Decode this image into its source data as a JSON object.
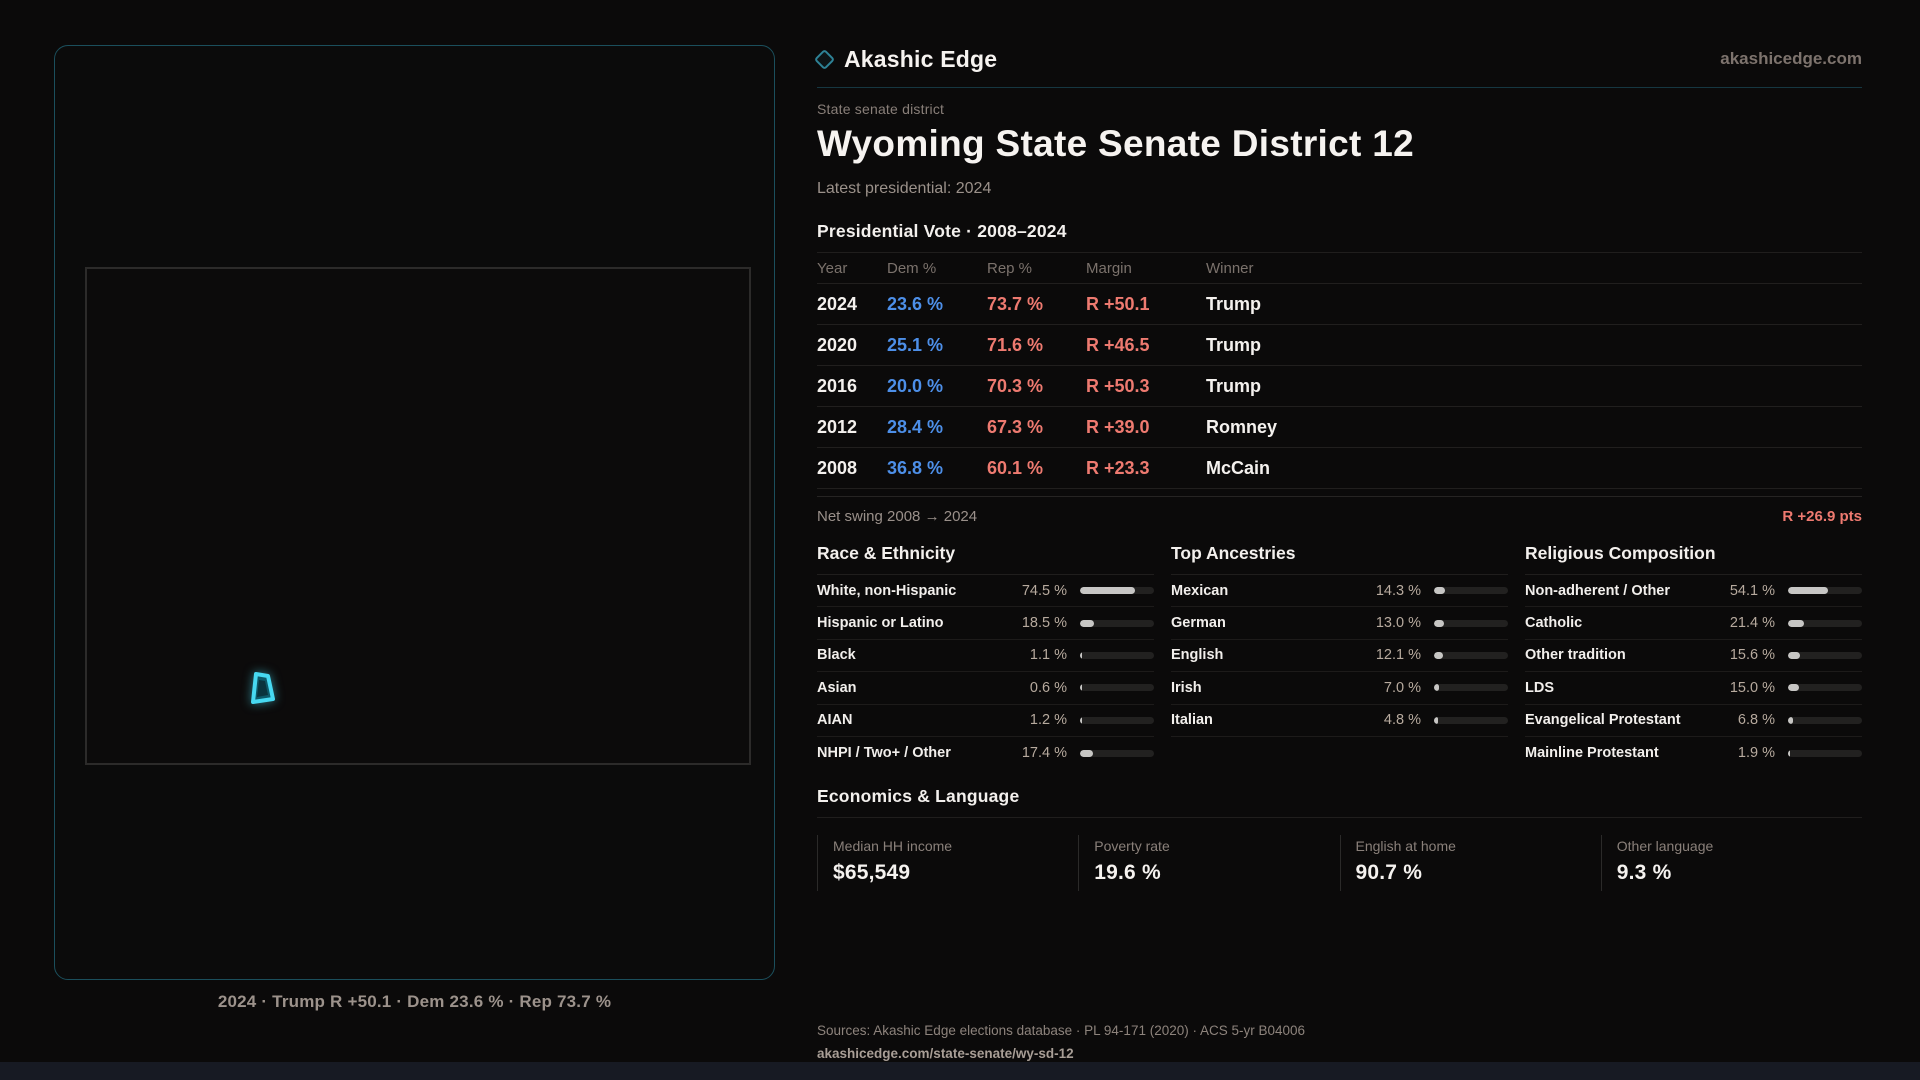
{
  "brand": {
    "name": "Akashic Edge",
    "domain": "akashicedge.com"
  },
  "page": {
    "eyebrow": "State senate district",
    "title": "Wyoming State Senate District 12",
    "latest": "Latest presidential: 2024"
  },
  "map": {
    "caption": "2024 · Trump R +50.1 · Dem 23.6 % · Rep 73.7 %",
    "district_color": "#47d9f1"
  },
  "vote_table": {
    "title": "Presidential Vote · 2008–2024",
    "columns": [
      "Year",
      "Dem %",
      "Rep %",
      "Margin",
      "Winner"
    ],
    "rows": [
      {
        "year": "2024",
        "dem": "23.6 %",
        "rep": "73.7 %",
        "margin": "R +50.1",
        "winner": "Trump"
      },
      {
        "year": "2020",
        "dem": "25.1 %",
        "rep": "71.6 %",
        "margin": "R +46.5",
        "winner": "Trump"
      },
      {
        "year": "2016",
        "dem": "20.0 %",
        "rep": "70.3 %",
        "margin": "R +50.3",
        "winner": "Trump"
      },
      {
        "year": "2012",
        "dem": "28.4 %",
        "rep": "67.3 %",
        "margin": "R +39.0",
        "winner": "Romney"
      },
      {
        "year": "2008",
        "dem": "36.8 %",
        "rep": "60.1 %",
        "margin": "R +23.3",
        "winner": "McCain"
      }
    ],
    "net_swing_label": "Net swing 2008 → 2024",
    "net_swing_value": "R +26.9 pts"
  },
  "demographics": [
    {
      "title": "Race & Ethnicity",
      "rows": [
        {
          "label": "White, non-Hispanic",
          "value": "74.5 %",
          "pct": 74.5
        },
        {
          "label": "Hispanic or Latino",
          "value": "18.5 %",
          "pct": 18.5
        },
        {
          "label": "Black",
          "value": "1.1 %",
          "pct": 1.1
        },
        {
          "label": "Asian",
          "value": "0.6 %",
          "pct": 0.6
        },
        {
          "label": "AIAN",
          "value": "1.2 %",
          "pct": 1.2
        },
        {
          "label": "NHPI / Two+ / Other",
          "value": "17.4 %",
          "pct": 17.4
        }
      ]
    },
    {
      "title": "Top Ancestries",
      "rows": [
        {
          "label": "Mexican",
          "value": "14.3 %",
          "pct": 14.3
        },
        {
          "label": "German",
          "value": "13.0 %",
          "pct": 13.0
        },
        {
          "label": "English",
          "value": "12.1 %",
          "pct": 12.1
        },
        {
          "label": "Irish",
          "value": "7.0 %",
          "pct": 7.0
        },
        {
          "label": "Italian",
          "value": "4.8 %",
          "pct": 4.8
        }
      ]
    },
    {
      "title": "Religious Composition",
      "rows": [
        {
          "label": "Non-adherent / Other",
          "value": "54.1 %",
          "pct": 54.1
        },
        {
          "label": "Catholic",
          "value": "21.4 %",
          "pct": 21.4
        },
        {
          "label": "Other tradition",
          "value": "15.6 %",
          "pct": 15.6
        },
        {
          "label": "LDS",
          "value": "15.0 %",
          "pct": 15.0
        },
        {
          "label": "Evangelical Protestant",
          "value": "6.8 %",
          "pct": 6.8
        },
        {
          "label": "Mainline Protestant",
          "value": "1.9 %",
          "pct": 1.9
        }
      ]
    }
  ],
  "economics": {
    "title": "Economics & Language",
    "stats": [
      {
        "label": "Median HH income",
        "value": "$65,549"
      },
      {
        "label": "Poverty rate",
        "value": "19.6 %"
      },
      {
        "label": "English at home",
        "value": "90.7 %"
      },
      {
        "label": "Other language",
        "value": "9.3 %"
      }
    ]
  },
  "footer": {
    "sources": "Sources: Akashic Edge elections database · PL 94-171 (2020) · ACS 5-yr B04006",
    "permalink": "akashicedge.com/state-senate/wy-sd-12"
  },
  "colors": {
    "dem": "#4d8fe8",
    "rep": "#ee7a70",
    "accent_teal": "#2e8296"
  }
}
